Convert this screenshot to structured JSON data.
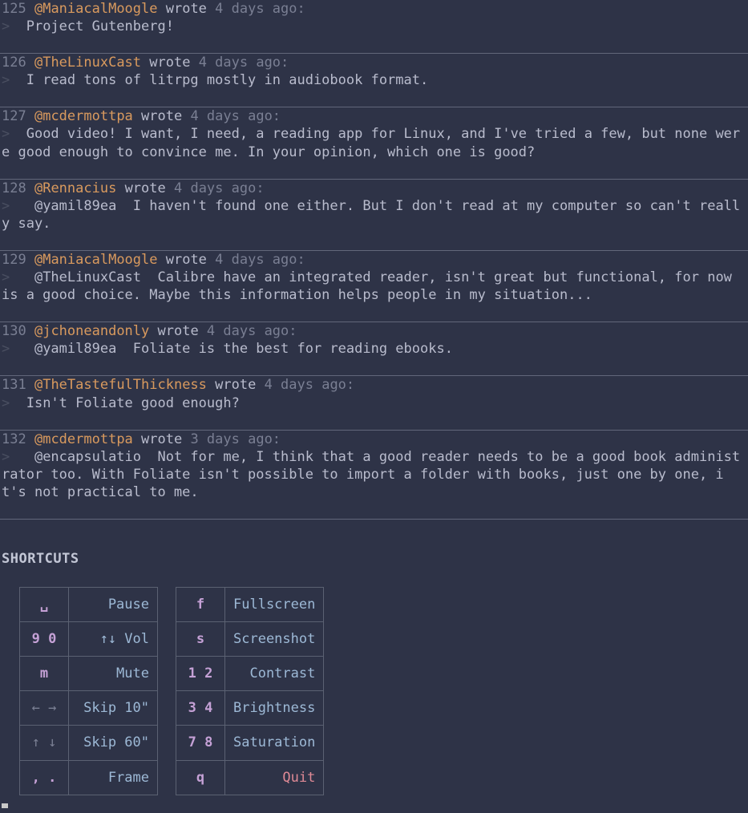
{
  "comments": [
    {
      "num": "125",
      "user": "@ManiacalMoogle",
      "wrote": " wrote ",
      "timestamp": "4 days ago:",
      "body": " Project Gutenberg!"
    },
    {
      "num": "126",
      "user": "@TheLinuxCast",
      "wrote": " wrote ",
      "timestamp": "4 days ago:",
      "body": " I read tons of litrpg mostly in audiobook format."
    },
    {
      "num": "127",
      "user": "@mcdermottpa",
      "wrote": " wrote ",
      "timestamp": "4 days ago:",
      "body": " Good video! I want, I need, a reading app for Linux, and I've tried a few, but none were good enough to convince me. In your opinion, which one is good?"
    },
    {
      "num": "128",
      "user": "@Rennacius",
      "wrote": " wrote ",
      "timestamp": "4 days ago:",
      "body": "  @yamil89ea  I haven't found one either. But I don't read at my computer so can't really say."
    },
    {
      "num": "129",
      "user": "@ManiacalMoogle",
      "wrote": " wrote ",
      "timestamp": "4 days ago:",
      "body": "  @TheLinuxCast  Calibre have an integrated reader, isn't great but functional, for now is a good choice. Maybe this information helps people in my situation..."
    },
    {
      "num": "130",
      "user": "@jchoneandonly",
      "wrote": " wrote ",
      "timestamp": "4 days ago:",
      "body": "  @yamil89ea  Foliate is the best for reading ebooks."
    },
    {
      "num": "131",
      "user": "@TheTastefulThickness",
      "wrote": " wrote ",
      "timestamp": "4 days ago:",
      "body": " Isn't Foliate good enough?"
    },
    {
      "num": "132",
      "user": "@mcdermottpa",
      "wrote": " wrote ",
      "timestamp": "3 days ago:",
      "body": "  @encapsulatio  Not for me, I think that a good reader needs to be a good book administrator too. With Foliate isn't possible to import a folder with books, just one by one, it's not practical to me."
    }
  ],
  "shortcuts_title": "SHORTCUTS",
  "table1": [
    {
      "key_html": "␣",
      "desc": "Pause"
    },
    {
      "key_html": "9 0",
      "desc": "↑↓ Vol",
      "arrows": "↑↓"
    },
    {
      "key_html": "m",
      "desc": "Mute"
    },
    {
      "key_html": "← →",
      "desc": "Skip 10\"",
      "is_arrow": true
    },
    {
      "key_html": "↑ ↓",
      "desc": "Skip 60\"",
      "is_arrow": true
    },
    {
      "key_html": ", .",
      "desc": "Frame"
    }
  ],
  "table2": [
    {
      "key_html": "f",
      "desc": "Fullscreen"
    },
    {
      "key_html": "s",
      "desc": "Screenshot"
    },
    {
      "key_html": "1 2",
      "desc": "Contrast"
    },
    {
      "key_html": "3 4",
      "desc": "Brightness"
    },
    {
      "key_html": "7 8",
      "desc": "Saturation"
    },
    {
      "key_html": "q",
      "desc": "Quit",
      "quit": true
    }
  ]
}
